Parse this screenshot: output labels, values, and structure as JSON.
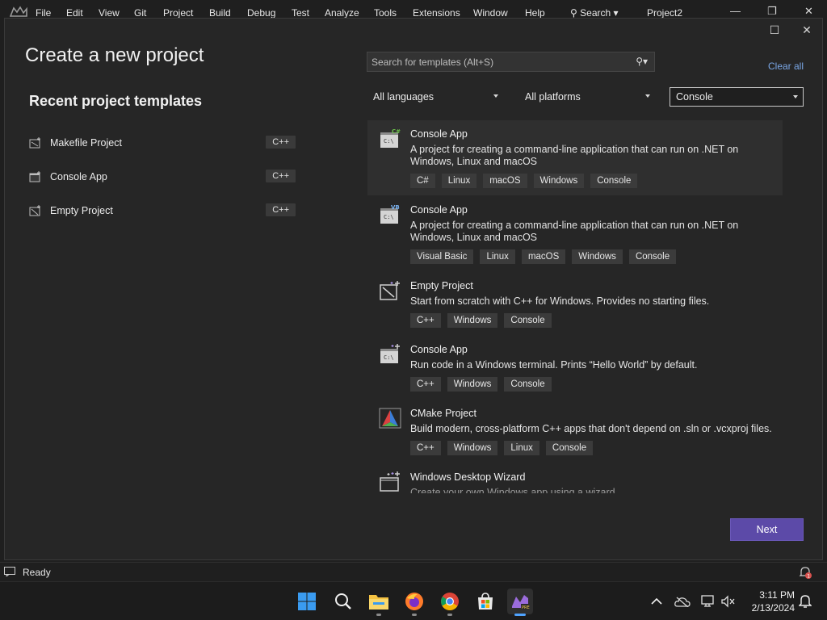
{
  "menubar": {
    "items": [
      "File",
      "Edit",
      "View",
      "Git",
      "Project",
      "Build",
      "Debug",
      "Test",
      "Analyze",
      "Tools",
      "Extensions",
      "Window",
      "Help"
    ],
    "search_label": "Search",
    "project_name": "Project2",
    "minimize_icon": "minimize-icon",
    "restore_icon": "restore-icon",
    "close_icon": "close-icon"
  },
  "dialog": {
    "title": "Create a new project",
    "recent_title": "Recent project templates",
    "recent": [
      {
        "label": "Makefile Project",
        "badge": "C++",
        "icon": "makefile-project-icon"
      },
      {
        "label": "Console App",
        "badge": "C++",
        "icon": "console-app-icon"
      },
      {
        "label": "Empty Project",
        "badge": "C++",
        "icon": "empty-project-icon"
      }
    ],
    "search": {
      "placeholder": "Search for templates (Alt+S)"
    },
    "clear_all": "Clear all",
    "filters": {
      "language": "All languages",
      "platform": "All platforms",
      "project_type": "Console"
    },
    "templates": [
      {
        "name": "Console App",
        "desc": "A project for creating a command-line application that can run on .NET on Windows, Linux and macOS",
        "tags": [
          "C#",
          "Linux",
          "macOS",
          "Windows",
          "Console"
        ],
        "icon": "csharp-console-icon",
        "badge": "C#"
      },
      {
        "name": "Console App",
        "desc": "A project for creating a command-line application that can run on .NET on Windows, Linux and macOS",
        "tags": [
          "Visual Basic",
          "Linux",
          "macOS",
          "Windows",
          "Console"
        ],
        "icon": "vb-console-icon",
        "badge": "VB"
      },
      {
        "name": "Empty Project",
        "desc": "Start from scratch with C++ for Windows. Provides no starting files.",
        "tags": [
          "C++",
          "Windows",
          "Console"
        ],
        "icon": "cpp-empty-project-icon"
      },
      {
        "name": "Console App",
        "desc": "Run code in a Windows terminal. Prints “Hello World” by default.",
        "tags": [
          "C++",
          "Windows",
          "Console"
        ],
        "icon": "cpp-console-icon"
      },
      {
        "name": "CMake Project",
        "desc": "Build modern, cross-platform C++ apps that don't depend on .sln or .vcxproj files.",
        "tags": [
          "C++",
          "Windows",
          "Linux",
          "Console"
        ],
        "icon": "cmake-icon"
      },
      {
        "name": "Windows Desktop Wizard",
        "desc": "Create your own Windows app using a wizard.",
        "tags": [],
        "icon": "desktop-wizard-icon"
      }
    ],
    "next_label": "Next"
  },
  "statusbar": {
    "text": "Ready",
    "notification_count": "1"
  },
  "taskbar": {
    "apps": [
      "windows-start-icon",
      "search-icon",
      "file-explorer-icon",
      "firefox-icon",
      "chrome-icon",
      "microsoft-store-icon",
      "visual-studio-icon"
    ],
    "time": "3:11 PM",
    "date": "2/13/2024"
  },
  "colors": {
    "accent": "#5c4aa8",
    "link": "#7aa7e6",
    "background": "#262626"
  }
}
